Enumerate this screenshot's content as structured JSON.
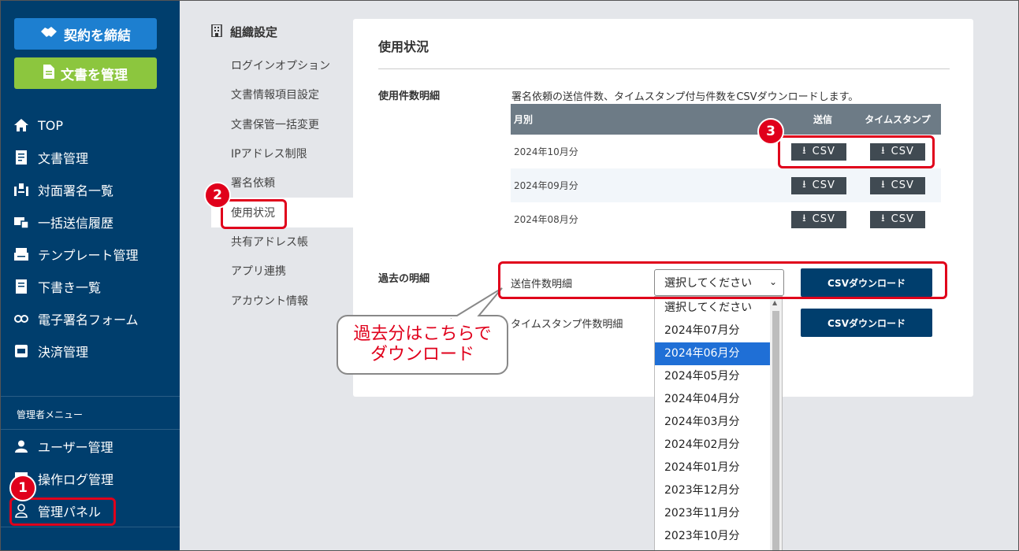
{
  "sidebar": {
    "contract_button": "契約を締結",
    "docs_button": "文書を管理",
    "items": [
      {
        "label": "TOP",
        "icon": "home-icon"
      },
      {
        "label": "文書管理",
        "icon": "document-icon"
      },
      {
        "label": "対面署名一覧",
        "icon": "face-sign-icon"
      },
      {
        "label": "一括送信履歴",
        "icon": "bulk-send-icon"
      },
      {
        "label": "テンプレート管理",
        "icon": "template-icon"
      },
      {
        "label": "下書き一覧",
        "icon": "draft-icon"
      },
      {
        "label": "電子署名フォーム",
        "icon": "link-icon"
      },
      {
        "label": "決済管理",
        "icon": "payment-icon"
      }
    ],
    "admin_label": "管理者メニュー",
    "admin_items": [
      {
        "label": "ユーザー管理",
        "icon": "user-icon"
      },
      {
        "label": "操作ログ管理",
        "icon": "log-icon"
      },
      {
        "label": "管理パネル",
        "icon": "admin-panel-icon"
      }
    ]
  },
  "settings": {
    "title": "組織設定",
    "items": [
      "ログインオプション",
      "文書情報項目設定",
      "文書保管一括変更",
      "IPアドレス制限",
      "署名依頼",
      "使用状況",
      "共有アドレス帳",
      "アプリ連携",
      "アカウント情報"
    ]
  },
  "panel": {
    "title": "使用状況",
    "detail_label": "使用件数明細",
    "description": "署名依頼の送信件数、タイムスタンプ付与件数をCSVダウンロードします。",
    "table": {
      "headers": [
        "月別",
        "送信",
        "タイムスタンプ"
      ],
      "rows": [
        "2024年10月分",
        "2024年09月分",
        "2024年08月分"
      ],
      "csv_label": "CSV"
    },
    "past_label": "過去の明細",
    "send_detail_label": "送信件数明細",
    "timestamp_detail_label": "タイムスタンプ件数明細",
    "select_value": "選択してください",
    "download_label": "CSVダウンロード"
  },
  "dropdown": {
    "options": [
      "選択してください",
      "2024年07月分",
      "2024年06月分",
      "2024年05月分",
      "2024年04月分",
      "2024年03月分",
      "2024年02月分",
      "2024年01月分",
      "2023年12月分",
      "2023年11月分",
      "2023年10月分"
    ],
    "selected": "2024年06月分"
  },
  "annotations": {
    "badge1": "1",
    "badge2": "2",
    "badge3": "3",
    "callout_line1": "過去分はこちらで",
    "callout_line2": "ダウンロード"
  },
  "colors": {
    "sidebar_bg": "#003e6d",
    "contract_btn": "#1d7fd0",
    "docs_btn": "#8cc63e",
    "highlight_red": "#e0001b",
    "selected_option": "#1f6fd6"
  }
}
